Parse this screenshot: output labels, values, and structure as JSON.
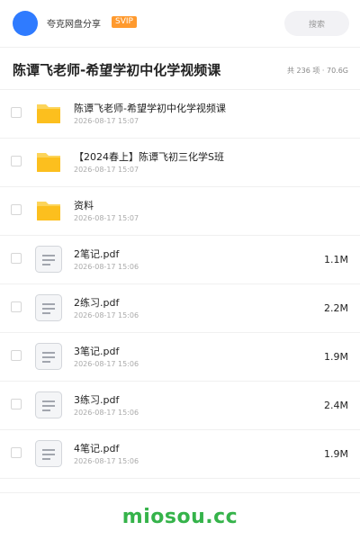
{
  "header": {
    "username": "夸克网盘分享",
    "badge": "SVIP",
    "search_placeholder": "搜索",
    "avatar_color": "#2f7bff"
  },
  "folder": {
    "title": "陈谭飞老师-希望学初中化学视频课",
    "meta": "共 236 项 · 70.6G"
  },
  "items": [
    {
      "type": "folder",
      "name": "陈谭飞老师-希望学初中化学视频课",
      "date": "2026-08-17 15:07",
      "size": ""
    },
    {
      "type": "folder",
      "name": "【2024春上】陈谭飞初三化学S班",
      "date": "2026-08-17 15:07",
      "size": ""
    },
    {
      "type": "folder",
      "name": "资料",
      "date": "2026-08-17 15:07",
      "size": ""
    },
    {
      "type": "file",
      "name": "2笔记.pdf",
      "date": "2026-08-17 15:06",
      "size": "1.1M"
    },
    {
      "type": "file",
      "name": "2练习.pdf",
      "date": "2026-08-17 15:06",
      "size": "2.2M"
    },
    {
      "type": "file",
      "name": "3笔记.pdf",
      "date": "2026-08-17 15:06",
      "size": "1.9M"
    },
    {
      "type": "file",
      "name": "3练习.pdf",
      "date": "2026-08-17 15:06",
      "size": "2.4M"
    },
    {
      "type": "file",
      "name": "4笔记.pdf",
      "date": "2026-08-17 15:06",
      "size": "1.9M"
    }
  ],
  "footer": {
    "watermark": "miosou.cc"
  }
}
